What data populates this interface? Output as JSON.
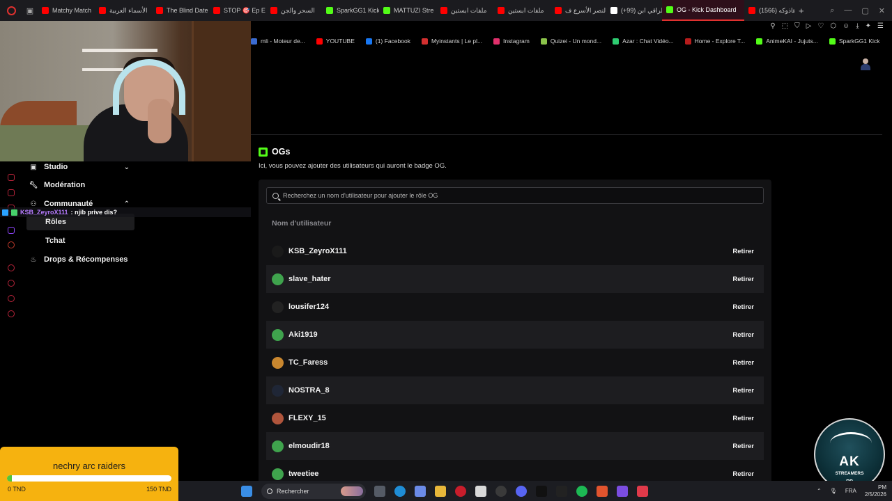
{
  "browser": {
    "tabs": [
      {
        "label": "Matchy Match",
        "color": "#ff0000"
      },
      {
        "label": "الأسماء العربية",
        "color": "#ff0000"
      },
      {
        "label": "The Blind Date",
        "color": "#ff0000"
      },
      {
        "label": "STOP 🎯 Ep E",
        "color": "#ff0000"
      },
      {
        "label": "السحر والجن",
        "color": "#ff0000"
      },
      {
        "label": "SparkGG1 Kick",
        "color": "#53fc18"
      },
      {
        "label": "MATTUZI Stre",
        "color": "#53fc18"
      },
      {
        "label": "ملفات ابستين",
        "color": "#ff0000"
      },
      {
        "label": "ملفات ابستين",
        "color": "#ff0000"
      },
      {
        "label": "النصر الأسرع ف",
        "color": "#ff0000"
      },
      {
        "label": "(+99) الراقي ابن",
        "color": "#ffffff"
      },
      {
        "label": "OG - Kick Dashboard",
        "color": "#53fc18"
      },
      {
        "label": "(1566) هاذوكه",
        "color": "#ff0000"
      }
    ],
    "active_tab_index": 11,
    "bookmarks": [
      {
        "label": "mli - Moteur de...",
        "color": "#3b6bd1"
      },
      {
        "label": "YOUTUBE",
        "color": "#ff0000"
      },
      {
        "label": "(1) Facebook",
        "color": "#1877f2"
      },
      {
        "label": "Myinstants | Le pl...",
        "color": "#d32f2f"
      },
      {
        "label": "Instagram",
        "color": "#e1306c"
      },
      {
        "label": "Quizei - Un mond...",
        "color": "#8bc34a"
      },
      {
        "label": "Azar : Chat Vidéo...",
        "color": "#2ecc71"
      },
      {
        "label": "Home - Explore T...",
        "color": "#b71c1c"
      },
      {
        "label": "AnimeKAI - Jujuts...",
        "color": "#53fc18"
      },
      {
        "label": "SparkGG1 Kick",
        "color": "#53fc18"
      }
    ]
  },
  "sidebar": {
    "items": [
      {
        "label": "Studio",
        "icon": "studio-icon",
        "chevron": "⌄"
      },
      {
        "label": "Modération",
        "icon": "wrench-icon"
      },
      {
        "label": "Communauté",
        "icon": "users-icon",
        "chevron": "⌃"
      }
    ],
    "sub_items": [
      {
        "label": "Rôles",
        "active": true
      },
      {
        "label": "Tchat"
      }
    ],
    "drops": {
      "label": "Drops & Récompenses",
      "icon": "cake-icon"
    }
  },
  "chat_overlay": {
    "user": "KSB_ZeyroX111",
    "message": ": njib prive dis?"
  },
  "main": {
    "title": "OGs",
    "description": "Ici, vous pouvez ajouter des utilisateurs qui auront le badge OG.",
    "search_placeholder": "Recherchez un nom d'utilisateur pour ajouter le rôle OG",
    "column_header": "Nom d'utilisateur",
    "remove_label": "Retirer",
    "users": [
      {
        "name": "KSB_ZeyroX111",
        "avatar_color": "#1a1a1a"
      },
      {
        "name": "slave_hater",
        "avatar_color": "#3fa34d"
      },
      {
        "name": "lousifer124",
        "avatar_color": "#222222"
      },
      {
        "name": "Aki1919",
        "avatar_color": "#3fa34d"
      },
      {
        "name": "TC_Faress",
        "avatar_color": "#c9872f"
      },
      {
        "name": "NOSTRA_8",
        "avatar_color": "#1f2636"
      },
      {
        "name": "FLEXY_15",
        "avatar_color": "#b0553c"
      },
      {
        "name": "elmoudir18",
        "avatar_color": "#3fa34d"
      },
      {
        "name": "tweetiee",
        "avatar_color": "#3fa34d"
      }
    ]
  },
  "goal": {
    "title": "nechry arc raiders",
    "min_label": "0 TND",
    "max_label": "150 TND",
    "progress": 0.03
  },
  "emblem": {
    "big": "AK",
    "sub": "STREAMERS",
    "rp": "RP"
  },
  "taskbar": {
    "search_label": "Rechercher",
    "language": "FRA",
    "time": "PM",
    "date": "2/5/2026"
  }
}
